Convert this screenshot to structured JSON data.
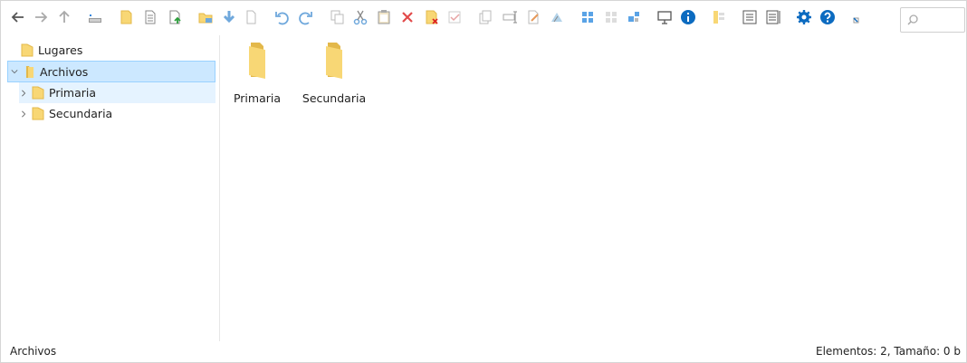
{
  "toolbar": {
    "icons": [
      "back-icon",
      "forward-icon",
      "up-icon",
      "drive-icon",
      "new-folder-icon",
      "new-file-icon",
      "upload-icon",
      "open-icon",
      "download-icon",
      "file-icon",
      "undo-icon",
      "redo-icon",
      "copy-icon",
      "cut-icon",
      "paste-icon",
      "delete-icon",
      "remove-icon",
      "select-icon",
      "duplicate-icon",
      "rename-icon",
      "edit-icon",
      "extract-icon",
      "large-icons-view-icon",
      "medium-icons-view-icon",
      "small-icons-view-icon",
      "preview-icon",
      "info-icon",
      "columns-icon",
      "list-view-icon",
      "details-view-icon",
      "settings-icon",
      "help-icon",
      "minimize-icon"
    ],
    "search_placeholder": ""
  },
  "tree": {
    "lugares": "Lugares",
    "archivos": "Archivos",
    "primaria": "Primaria",
    "secundaria": "Secundaria"
  },
  "content": {
    "items": [
      {
        "name": "Primaria"
      },
      {
        "name": "Secundaria"
      }
    ]
  },
  "status": {
    "path": "Archivos",
    "summary": "Elementos: 2, Tamaño: 0 b"
  },
  "colors": {
    "selection_bg": "#cce8ff",
    "selection_border": "#99d1ff",
    "hover_bg": "#e5f3ff",
    "folder": "#f8d775",
    "accent": "#1f77c9"
  }
}
